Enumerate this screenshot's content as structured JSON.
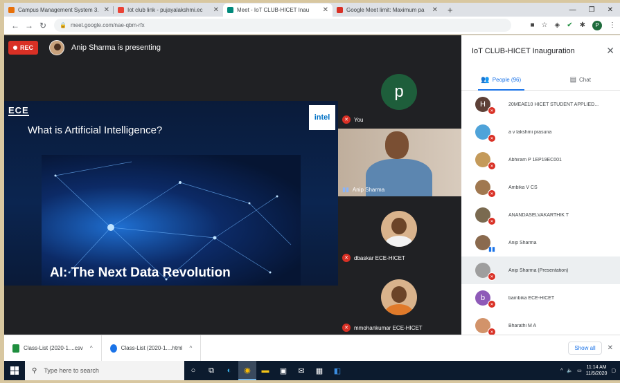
{
  "browser": {
    "tabs": [
      {
        "label": "Campus Management System 3.",
        "color": "#e8710a",
        "active": false
      },
      {
        "label": "Iot club link - pujayalakshmi.ec",
        "color": "#ea4335",
        "active": false
      },
      {
        "label": "Meet - IoT CLUB-HICET Inau",
        "color": "#00897b",
        "active": true
      },
      {
        "label": "Google Meet limit: Maximum pa",
        "color": "#d93025",
        "active": false
      }
    ],
    "new_tab": "+",
    "url": "meet.google.com/nae-qbm-rfx",
    "profile_initial": "P"
  },
  "meet": {
    "rec_label": "REC",
    "presenting_text": "Anip Sharma is presenting",
    "slide": {
      "logo": "ECE",
      "intel": "intel",
      "title": "What is Artificial Intelligence?",
      "subtitle": "AI: The Next Data Revolution"
    },
    "tiles": [
      {
        "name": "You",
        "initial": "p",
        "color": "#1e5e3b",
        "kind": "avatar",
        "mic": "off"
      },
      {
        "name": "Anip Sharma",
        "kind": "video",
        "mic": "on"
      },
      {
        "name": "dbaskar ECE-HICET",
        "kind": "photo",
        "mic": "off"
      },
      {
        "name": "mmohankumar ECE-HICET",
        "kind": "photo",
        "mic": "off"
      }
    ]
  },
  "panel": {
    "title": "IoT CLUB-HICET Inauguration",
    "people_tab": "People (96)",
    "chat_tab": "Chat",
    "people": [
      {
        "name": "20MEAE10 HICET STUDENT APPLIED...",
        "initial": "H",
        "color": "#5d4037",
        "mic": "off"
      },
      {
        "name": "a v lakshmi prasuna",
        "initial": "",
        "color": "#4fa3d9",
        "mic": "off"
      },
      {
        "name": "Abhiram P 1EP19EC001",
        "initial": "",
        "color": "#c49a5a",
        "mic": "off"
      },
      {
        "name": "Ambika V CS",
        "initial": "",
        "color": "#a07850",
        "mic": "off"
      },
      {
        "name": "ANANDASELVAKARTHIK T",
        "initial": "",
        "color": "#7a6a50",
        "mic": "off"
      },
      {
        "name": "Anip Sharma",
        "initial": "",
        "color": "#8a6a4e",
        "mic": "on"
      },
      {
        "name": "Anip Sharma (Presentation)",
        "initial": "",
        "color": "#9e9e9e",
        "mic": "off"
      },
      {
        "name": "bambika ECE-HICET",
        "initial": "b",
        "color": "#8e5ab8",
        "mic": "off"
      },
      {
        "name": "Bharathi M A",
        "initial": "",
        "color": "#d2936a",
        "mic": "off"
      }
    ]
  },
  "downloads": {
    "items": [
      {
        "label": "Class-List (2020-1....csv",
        "color": "#1e8e3e"
      },
      {
        "label": "Class-List (2020-1....html",
        "color": "#1a73e8"
      }
    ],
    "show_all": "Show all"
  },
  "taskbar": {
    "search_placeholder": "Type here to search",
    "time": "11:14 AM",
    "date": "11/5/2020"
  }
}
